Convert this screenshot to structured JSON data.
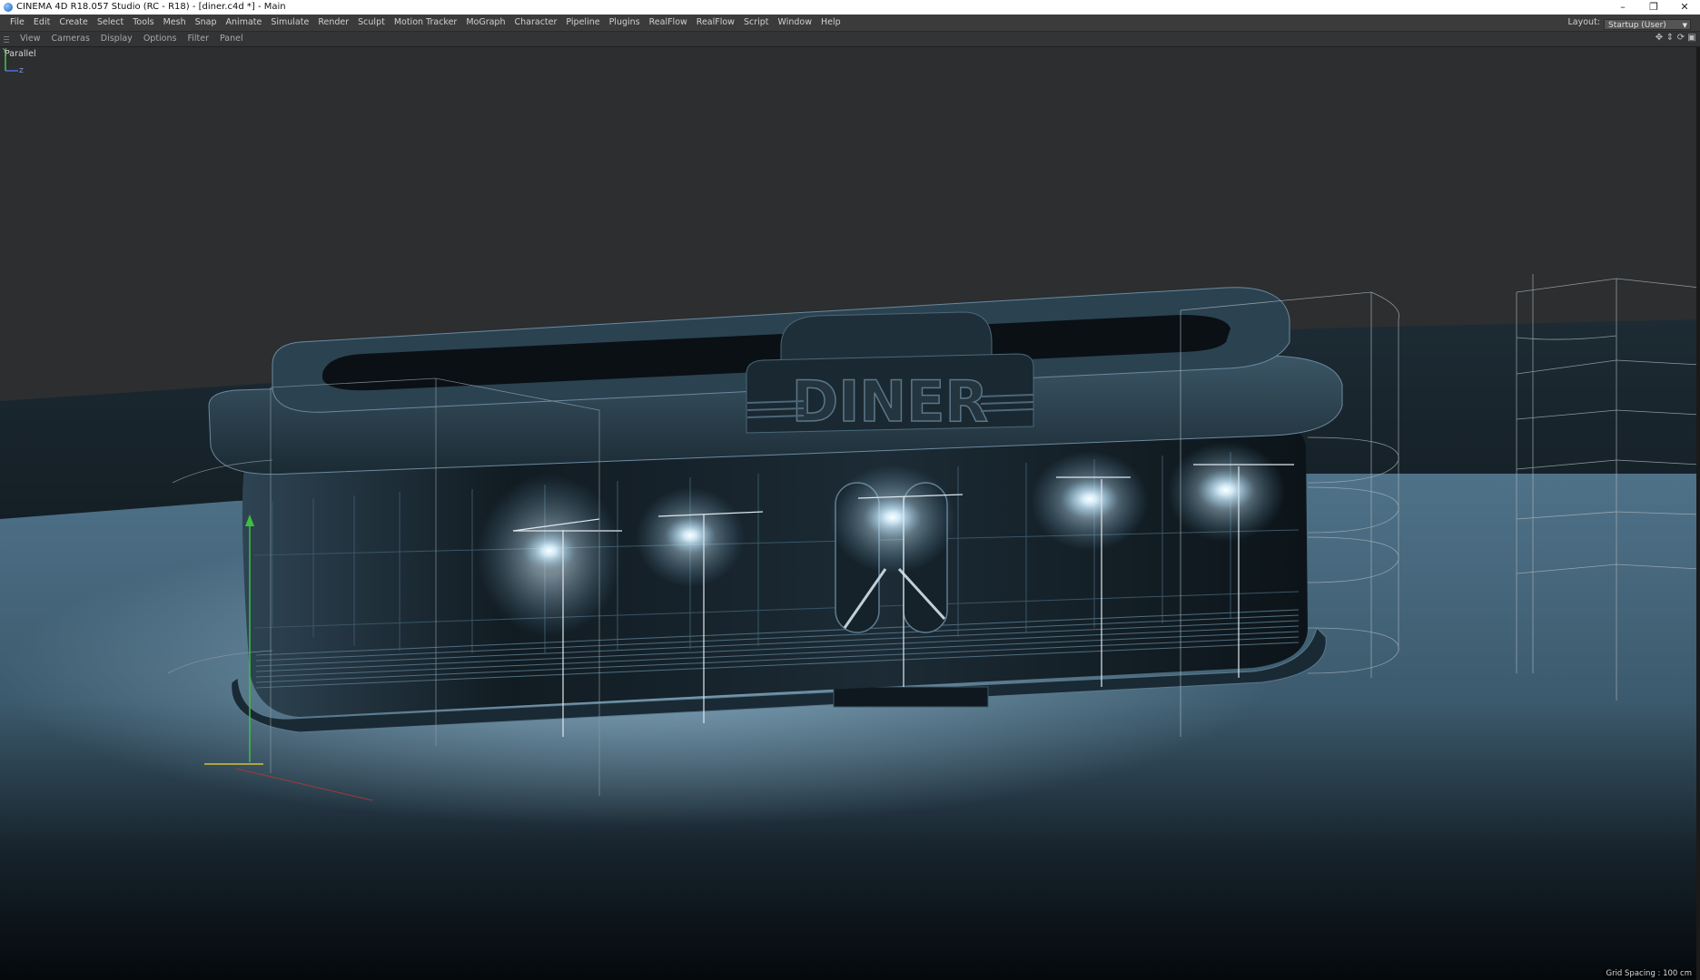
{
  "window": {
    "title": "CINEMA 4D R18.057 Studio (RC - R18) - [diner.c4d *] - Main",
    "controls": [
      "minimize-icon",
      "restore-icon",
      "close-icon"
    ]
  },
  "menubar": {
    "items": [
      "File",
      "Edit",
      "Create",
      "Select",
      "Tools",
      "Mesh",
      "Snap",
      "Animate",
      "Simulate",
      "Render",
      "Sculpt",
      "Motion Tracker",
      "MoGraph",
      "Character",
      "Pipeline",
      "Plugins",
      "RealFlow",
      "RealFlow",
      "Script",
      "Window",
      "Help"
    ],
    "layout_label": "Layout:",
    "layout_value": "Startup (User)"
  },
  "viewport_menu": {
    "items": [
      "View",
      "Cameras",
      "Display",
      "Options",
      "Filter",
      "Panel"
    ],
    "nav_icons": [
      "move-icon",
      "zoom-icon",
      "rotate-icon",
      "maximize-view-icon"
    ]
  },
  "viewport": {
    "label": "Parallel",
    "sign_text": "DINER",
    "grid_spacing": "Grid Spacing : 100 cm",
    "axis_labels": {
      "y": "Y",
      "z": "Z"
    },
    "colors": {
      "background": "#2c2d2e",
      "floor": "#5a7d95",
      "lamp_glow": "#e8f6ff",
      "wireframe": "#c8d2d8"
    }
  }
}
